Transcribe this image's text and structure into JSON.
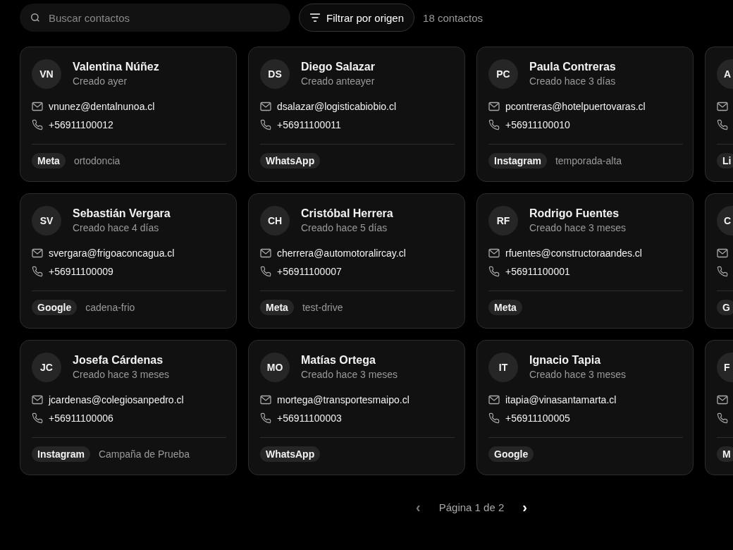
{
  "search": {
    "placeholder": "Buscar contactos"
  },
  "filter_button": {
    "label": "Filtrar por origen"
  },
  "count": "18 contactos",
  "rows": [
    {
      "contacts": [
        {
          "initials": "VN",
          "name": "Valentina Núñez",
          "created": "Creado ayer",
          "email": "vnunez@dentalnunoa.cl",
          "phone": "+56911100012",
          "source": "Meta",
          "tag": "ortodoncia"
        },
        {
          "initials": "DS",
          "name": "Diego Salazar",
          "created": "Creado anteayer",
          "email": "dsalazar@logisticabiobio.cl",
          "phone": "+56911100011",
          "source": "WhatsApp"
        },
        {
          "initials": "PC",
          "name": "Paula Contreras",
          "created": "Creado hace 3 días",
          "email": "pcontreras@hotelpuertovaras.cl",
          "phone": "+56911100010",
          "source": "Instagram",
          "tag": "temporada-alta"
        },
        {
          "initials": "A",
          "source": "Li"
        }
      ]
    },
    {
      "contacts": [
        {
          "initials": "SV",
          "name": "Sebastián Vergara",
          "created": "Creado hace 4 días",
          "email": "svergara@frigoaconcagua.cl",
          "phone": "+56911100009",
          "source": "Google",
          "tag": "cadena-frio"
        },
        {
          "initials": "CH",
          "name": "Cristóbal Herrera",
          "created": "Creado hace 5 días",
          "email": "cherrera@automotoralircay.cl",
          "phone": "+56911100007",
          "source": "Meta",
          "tag": "test-drive"
        },
        {
          "initials": "RF",
          "name": "Rodrigo Fuentes",
          "created": "Creado hace 3 meses",
          "email": "rfuentes@constructoraandes.cl",
          "phone": "+56911100001",
          "source": "Meta"
        },
        {
          "initials": "C",
          "source": "G"
        }
      ]
    },
    {
      "contacts": [
        {
          "initials": "JC",
          "name": "Josefa Cárdenas",
          "created": "Creado hace 3 meses",
          "email": "jcardenas@colegiosanpedro.cl",
          "phone": "+56911100006",
          "source": "Instagram",
          "tag": "Campaña de Prueba"
        },
        {
          "initials": "MO",
          "name": "Matías Ortega",
          "created": "Creado hace 3 meses",
          "email": "mortega@transportesmaipo.cl",
          "phone": "+56911100003",
          "source": "WhatsApp"
        },
        {
          "initials": "IT",
          "name": "Ignacio Tapia",
          "created": "Creado hace 3 meses",
          "email": "itapia@vinasantamarta.cl",
          "phone": "+56911100005",
          "source": "Google"
        },
        {
          "initials": "F",
          "source": "M"
        }
      ]
    }
  ],
  "pagination": {
    "previous": {
      "label": "‹",
      "disabled": true
    },
    "page": "Página 1 de 2",
    "next": {
      "label": "›",
      "disabled": false
    }
  }
}
